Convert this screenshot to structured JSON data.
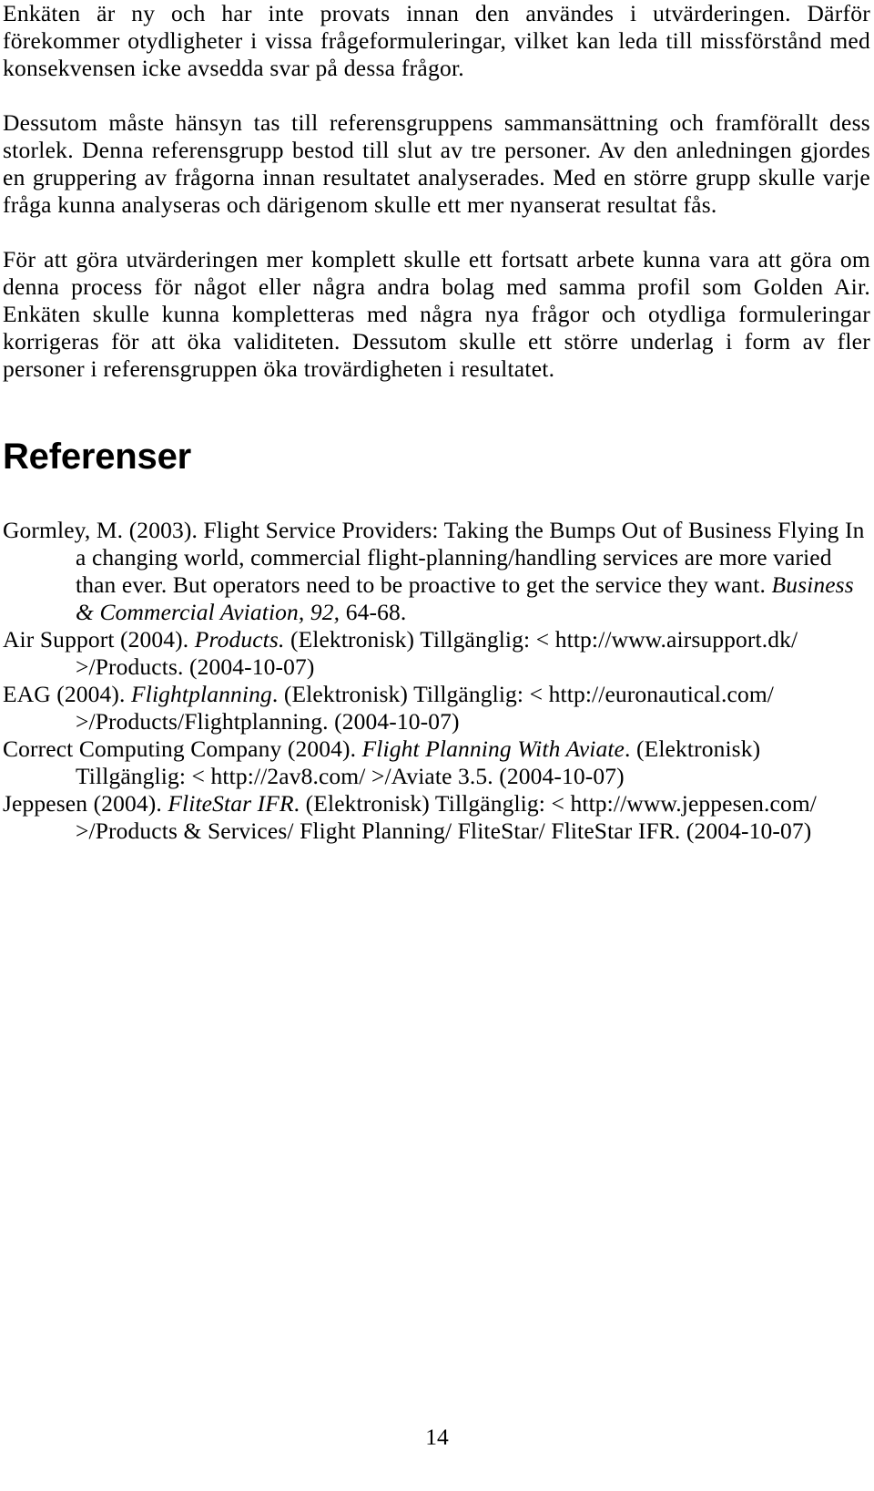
{
  "document": {
    "language": "sv",
    "page_number": "14"
  },
  "body": {
    "paragraphs": [
      "Enkäten är ny och har inte provats innan den användes i utvärderingen. Därför förekommer otydligheter i vissa frågeformuleringar, vilket kan leda till missförstånd med konsekvensen icke avsedda svar på dessa frågor.",
      "Dessutom måste hänsyn tas till referensgruppens sammansättning och framförallt dess storlek. Denna referensgrupp bestod till slut av tre personer. Av den anledningen gjordes en gruppering av frågorna innan resultatet analyserades. Med en större grupp skulle varje fråga kunna analyseras och därigenom skulle ett mer nyanserat resultat fås.",
      "För att göra utvärderingen mer komplett skulle ett fortsatt arbete kunna vara att göra om denna process för något eller några andra bolag med samma profil som Golden Air. Enkäten skulle kunna kompletteras med några nya frågor och otydliga formuleringar korrigeras för att öka validiteten. Dessutom skulle ett större underlag i form av fler personer i referensgruppen öka trovärdigheten i resultatet."
    ]
  },
  "references_section": {
    "heading": "Referenser",
    "entries": [
      {
        "id": "gormley-2003",
        "parts": [
          {
            "text": "Gormley, M. (2003). Flight Service Providers: Taking the Bumps Out of Business Flying In a changing world, commercial flight-planning/handling services are more varied than ever. But operators need to be proactive to get the service they want. ",
            "style": "normal"
          },
          {
            "text": "Business & Commercial Aviation, 92,",
            "style": "italic"
          },
          {
            "text": " 64-68.",
            "style": "normal"
          }
        ]
      },
      {
        "id": "air-support-2004",
        "parts": [
          {
            "text": "Air Support (2004). ",
            "style": "normal"
          },
          {
            "text": "Products.",
            "style": "italic"
          },
          {
            "text": " (Elektronisk) Tillgänglig: < http://www.airsupport.dk/ >/Products. (2004-10-07)",
            "style": "normal"
          }
        ]
      },
      {
        "id": "eag-2004",
        "parts": [
          {
            "text": "EAG (2004). ",
            "style": "normal"
          },
          {
            "text": "Flightplanning",
            "style": "italic"
          },
          {
            "text": ". (Elektronisk) Tillgänglig: < http://euronautical.com/ >/Products/Flightplanning. (2004-10-07)",
            "style": "normal"
          }
        ]
      },
      {
        "id": "correct-computing-2004",
        "parts": [
          {
            "text": "Correct Computing Company (2004). ",
            "style": "normal"
          },
          {
            "text": "Flight Planning With Aviate",
            "style": "italic"
          },
          {
            "text": ". (Elektronisk) Tillgänglig: < http://2av8.com/ >/Aviate 3.5. (2004-10-07)",
            "style": "normal"
          }
        ]
      },
      {
        "id": "jeppesen-2004",
        "parts": [
          {
            "text": "Jeppesen (2004). ",
            "style": "normal"
          },
          {
            "text": "FliteStar IFR",
            "style": "italic"
          },
          {
            "text": ". (Elektronisk) Tillgänglig: < http://www.jeppesen.com/ >/Products & Services/ Flight Planning/ FliteStar/ FliteStar IFR. (2004-10-07)",
            "style": "normal"
          }
        ]
      }
    ]
  }
}
